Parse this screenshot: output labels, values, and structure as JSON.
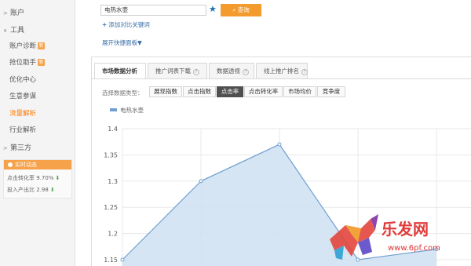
{
  "sidebar": {
    "groups": [
      {
        "label": "账户",
        "expanded": false
      },
      {
        "label": "工具",
        "expanded": true
      },
      {
        "label": "第三方",
        "expanded": false
      }
    ],
    "items": [
      {
        "label": "账户诊断",
        "badge": "新"
      },
      {
        "label": "抢位助手",
        "badge": "新"
      },
      {
        "label": "优化中心",
        "badge": ""
      },
      {
        "label": "生意参谋",
        "badge": ""
      },
      {
        "label": "流量解析",
        "badge": "",
        "active": true
      },
      {
        "label": "行业解析",
        "badge": ""
      }
    ],
    "realtime": {
      "title": "实时动态",
      "rows": [
        {
          "label": "点击转化率",
          "value": "9.70%",
          "trend": "down"
        },
        {
          "label": "投入产出比",
          "value": "2.98",
          "trend": "down"
        }
      ]
    }
  },
  "search": {
    "value": "电热水壶",
    "button_label": "查询",
    "add_compare": "添加对比关键词",
    "expand_panel": "展开快捷面板"
  },
  "tabs": [
    {
      "label": "市场数据分析",
      "active": true
    },
    {
      "label": "推广词表下载",
      "active": false
    },
    {
      "label": "数据透视",
      "active": false
    },
    {
      "label": "线上推广排名",
      "active": false
    }
  ],
  "data_types": {
    "label": "选择数据类型：",
    "options": [
      {
        "label": "展现指数",
        "active": false
      },
      {
        "label": "点击指数",
        "active": false
      },
      {
        "label": "点击率",
        "active": true
      },
      {
        "label": "点击转化率",
        "active": false
      },
      {
        "label": "市场均价",
        "active": false
      },
      {
        "label": "竞争度",
        "active": false
      }
    ]
  },
  "colors": {
    "accent": "#f39b2d",
    "link": "#3a6ea8",
    "line": "#6f9fd0",
    "area": "#cfe0f2"
  },
  "watermark": {
    "brand": "乐发网",
    "url": "www.6pf.com"
  },
  "chart_data": {
    "type": "area",
    "legend": [
      "电热水壶"
    ],
    "y_ticks": [
      "1.4",
      "1.35",
      "1.3",
      "1.25",
      "1.2",
      "1.15"
    ],
    "ylim": [
      1.15,
      1.4
    ],
    "series": [
      {
        "name": "电热水壶",
        "values": [
          1.15,
          1.3,
          1.37,
          1.15,
          1.17
        ]
      }
    ],
    "grid": true
  }
}
